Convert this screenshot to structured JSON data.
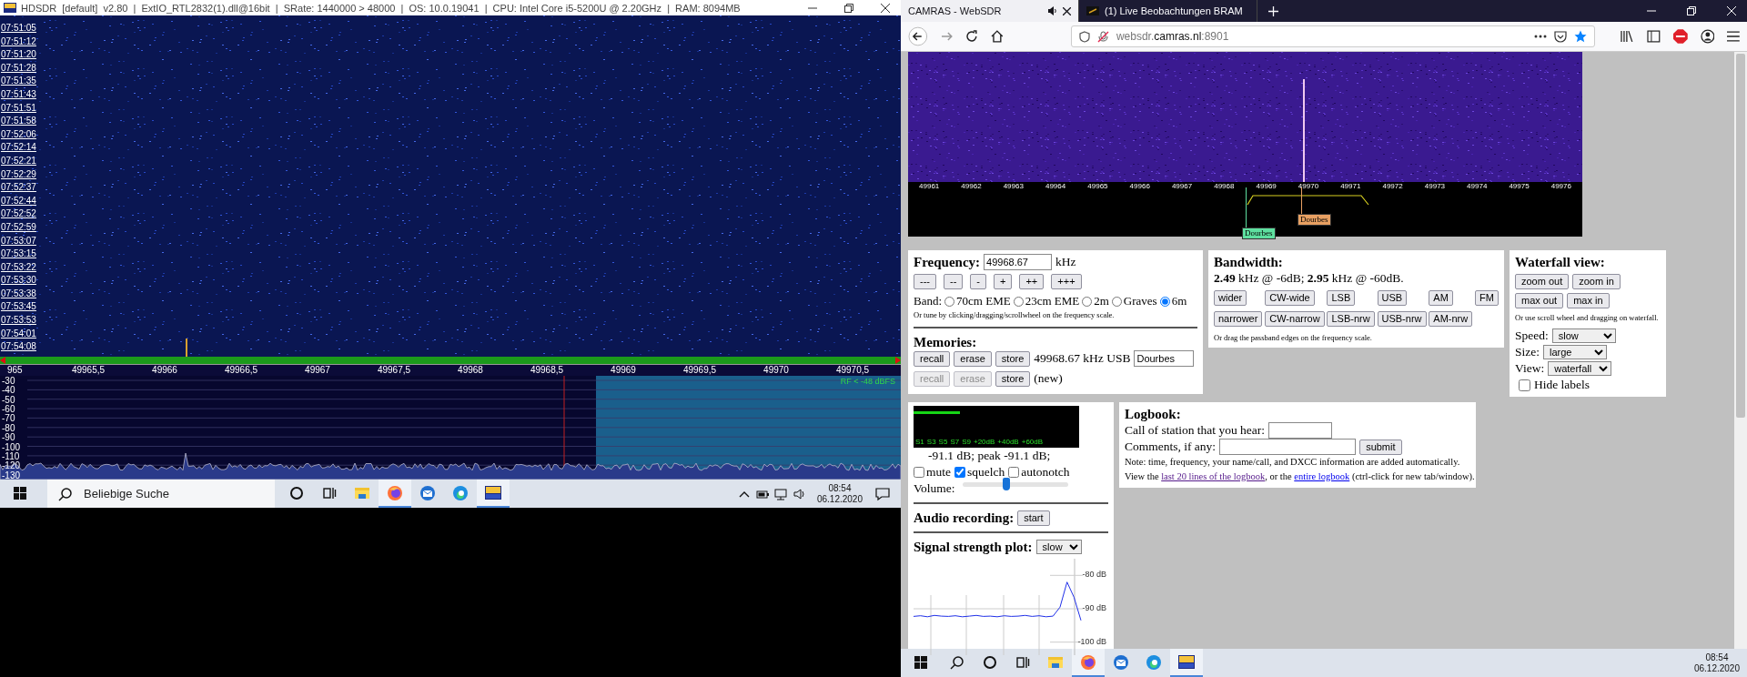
{
  "hdsdr": {
    "title": "HDSDR  [default]  v2.80  |  ExtIO_RTL2832(1).dll@16bit  |  SRate: 1440000 > 48000  |  OS: 10.0.19041  |  CPU: Intel Core i5-5200U @ 2.20GHz  |  RAM: 8094MB",
    "timestamps": [
      "07:51:05",
      "07:51:12",
      "07:51:20",
      "07:51:28",
      "07:51:35",
      "07:51:43",
      "07:51:51",
      "07:51:58",
      "07:52:06",
      "07:52:14",
      "07:52:21",
      "07:52:29",
      "07:52:37",
      "07:52:44",
      "07:52:52",
      "07:52:59",
      "07:53:07",
      "07:53:15",
      "07:53:22",
      "07:53:30",
      "07:53:38",
      "07:53:45",
      "07:53:53",
      "07:54:01",
      "07:54:08"
    ],
    "freq_labels": [
      "965",
      "49965,5",
      "49966",
      "49966,5",
      "49967",
      "49967,5",
      "49968",
      "49968,5",
      "49969",
      "49969,5",
      "49970",
      "49970,5"
    ],
    "level_labels": [
      "-30",
      "-40",
      "-50",
      "-60",
      "-70",
      "-80",
      "-90",
      "-100",
      "-110",
      "-120",
      "-130"
    ],
    "rf_indicator": "RF < -48 dBFS"
  },
  "taskbar_left": {
    "search_placeholder": "Beliebige Suche",
    "apps": [
      {
        "kind": "cortana",
        "active": false
      },
      {
        "kind": "taskview",
        "active": false
      },
      {
        "kind": "explorer",
        "active": false
      },
      {
        "kind": "firefox",
        "active": true
      },
      {
        "kind": "thunderbird",
        "active": false
      },
      {
        "kind": "edge",
        "active": false
      },
      {
        "kind": "hdsdr",
        "active": true
      }
    ],
    "time": "08:54",
    "date": "06.12.2020"
  },
  "browser": {
    "tabs": [
      {
        "label": "CAMRAS - WebSDR",
        "selected": true,
        "audio": true
      },
      {
        "label": "(1) Live Beobachtungen BRAM",
        "selected": false,
        "audio": false
      }
    ],
    "url": "websdr.**camras.nl**:8901",
    "scale_labels": [
      "49961",
      "49962",
      "49963",
      "49964",
      "49965",
      "49966",
      "49967",
      "49968",
      "49969",
      "49970",
      "49971",
      "49972",
      "49973",
      "49974",
      "49975",
      "49976"
    ],
    "markers": [
      {
        "label": "Dourbes",
        "color": "#5ee0a0"
      },
      {
        "label": "Dourbes",
        "color": "#e8a062"
      }
    ],
    "frequency": {
      "title": "Frequency:",
      "value": "49968.67",
      "unit": "kHz",
      "step_buttons": [
        "---",
        "--",
        "-",
        "+",
        "++",
        "+++"
      ],
      "band_label": "Band:",
      "bands": [
        {
          "label": "70cm EME",
          "selected": false
        },
        {
          "label": "23cm EME",
          "selected": false
        },
        {
          "label": "2m",
          "selected": false
        },
        {
          "label": "Graves",
          "selected": false
        },
        {
          "label": "6m",
          "selected": true
        }
      ],
      "hint": "Or tune by clicking/dragging/scrollwheel on the frequency scale."
    },
    "memories": {
      "title": "Memories:",
      "rows": [
        {
          "buttons": [
            {
              "label": "recall",
              "disabled": false
            },
            {
              "label": "erase",
              "disabled": false
            },
            {
              "label": "store",
              "disabled": false
            }
          ],
          "text": "49968.67 kHz USB",
          "name": "Dourbes"
        },
        {
          "buttons": [
            {
              "label": "recall",
              "disabled": true
            },
            {
              "label": "erase",
              "disabled": true
            },
            {
              "label": "store",
              "disabled": false
            }
          ],
          "text": "(new)"
        }
      ]
    },
    "bandwidth": {
      "title": "Bandwidth:",
      "summary": "**2.49** kHz @ -6dB; **2.95** kHz @ -60dB.",
      "buttons": [
        [
          "wider",
          "CW-wide",
          "LSB",
          "USB",
          "AM",
          "FM"
        ],
        [
          "narrower",
          "CW-narrow",
          "LSB-nrw",
          "USB-nrw",
          "AM-nrw"
        ]
      ],
      "hint": "Or drag the passband edges on the frequency scale."
    },
    "waterfall_view": {
      "title": "Waterfall view:",
      "buttons": [
        [
          "zoom out",
          "zoom in"
        ],
        [
          "max out",
          "max in"
        ]
      ],
      "hint": "Or use scroll wheel and dragging on waterfall.",
      "selects": [
        {
          "label": "Speed:",
          "value": "slow"
        },
        {
          "label": "Size:",
          "value": "large"
        },
        {
          "label": "View:",
          "value": "waterfall"
        }
      ],
      "hide_labels": {
        "label": "Hide labels",
        "checked": false
      }
    },
    "audio": {
      "meter": {
        "labels": [
          "S1",
          "S3",
          "S5",
          "S7",
          "S9",
          "+20dB",
          "+40dB",
          "+60dB"
        ],
        "level": 0.28
      },
      "reading": "-91.1 dB; peak  -91.1 dB;",
      "options": [
        {
          "label": "mute",
          "checked": false
        },
        {
          "label": "squelch",
          "checked": true
        },
        {
          "label": "autonotch",
          "checked": false
        }
      ],
      "volume": {
        "label": "Volume:",
        "level": 0.42
      },
      "recording_label": "Audio recording:",
      "recording_button": "start",
      "plot_label": "Signal strength plot:",
      "plot_speed": "slow",
      "chart_data": {
        "type": "line",
        "grid": true,
        "ylim": [
          -105,
          -75
        ],
        "yticks": [
          {
            "value": -80,
            "label": "-80 dB"
          },
          {
            "value": -90,
            "label": "-90 dB"
          },
          {
            "value": -100,
            "label": "-100 dB"
          }
        ],
        "series": [
          {
            "color": "#2030e8",
            "values": [
              -92.3,
              -92.1,
              -92.4,
              -92.0,
              -92.2,
              -92.3,
              -92.1,
              -92.4,
              -92.2,
              -92.0,
              -92.3,
              -92.2,
              -92.4,
              -92.1,
              -92.3,
              -92.2,
              -92.0,
              -92.3,
              -92.1,
              -92.4,
              -92.2,
              -89.5,
              -82.0,
              -86.5,
              -93.5
            ]
          }
        ]
      }
    }
  },
  "logbook": {
    "title": "Logbook:",
    "call_label": "Call of station that you hear:",
    "comments_label": "Comments, if any:",
    "submit": "submit",
    "note": "Note: time, frequency, your name/call, and DXCC information are added automatically.",
    "view_parts": [
      {
        "kind": "text",
        "text": "View the "
      },
      {
        "kind": "link",
        "text": "last 20 lines of the logbook",
        "visited": true
      },
      {
        "kind": "text",
        "text": ", or the "
      },
      {
        "kind": "link",
        "text": "entire logbook",
        "visited": false
      },
      {
        "kind": "text",
        "text": " (ctrl-click for new tab/window)."
      }
    ]
  },
  "taskbar_right": {
    "apps": [
      {
        "kind": "search",
        "active": false
      },
      {
        "kind": "cortana",
        "active": false
      },
      {
        "kind": "taskview",
        "active": false
      },
      {
        "kind": "explorer",
        "active": false
      },
      {
        "kind": "firefox",
        "active": true
      },
      {
        "kind": "thunderbird",
        "active": false
      },
      {
        "kind": "edge",
        "active": false
      },
      {
        "kind": "hdsdr",
        "active": true
      }
    ],
    "time": "08:54",
    "date": "06.12.2020"
  }
}
